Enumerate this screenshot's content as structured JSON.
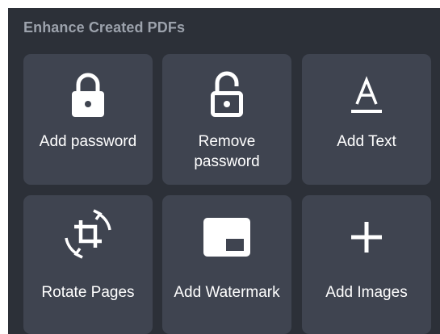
{
  "section": {
    "title": "Enhance Created PDFs"
  },
  "colors": {
    "background": "#2c3038",
    "tile": "#3f4450",
    "title_text": "#9ca2ac",
    "label_text": "#ffffff"
  },
  "tools": [
    {
      "label": "Add password",
      "icon": "lock-closed-icon"
    },
    {
      "label": "Remove password",
      "icon": "lock-open-icon"
    },
    {
      "label": "Add Text",
      "icon": "text-format-icon"
    },
    {
      "label": "Rotate Pages",
      "icon": "rotate-crop-icon"
    },
    {
      "label": "Add Watermark",
      "icon": "watermark-icon"
    },
    {
      "label": "Add Images",
      "icon": "plus-icon"
    }
  ]
}
